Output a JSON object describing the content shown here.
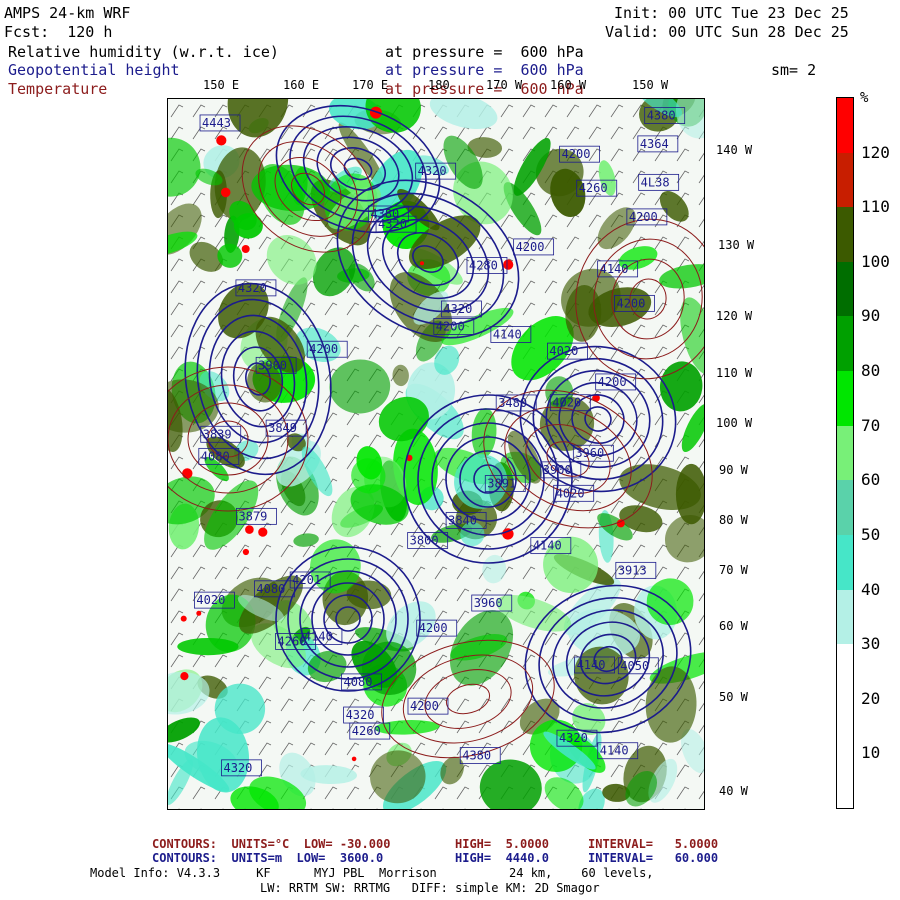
{
  "header": {
    "model": "AMPS 24-km WRF",
    "fcst": "Fcst:  120 h",
    "init": "Init: 00 UTC Tue 23 Dec 25",
    "valid": "Valid: 00 UTC Sun 28 Dec 25",
    "field1": "Relative humidity (w.r.t. ice)",
    "field1_level": "at pressure =  600 hPa",
    "field2": "Geopotential height",
    "field2_level": "at pressure =  600 hPa",
    "field3": "Temperature",
    "field3_level": "at pressure =  600 hPa",
    "smoothing": "sm= 2"
  },
  "top_lon_labels": [
    "150 E",
    "160 E",
    "170 E",
    "180",
    "170 W",
    "160 W",
    "150 W"
  ],
  "right_lat_labels": [
    "140 W",
    "130 W",
    "120 W",
    "110 W",
    "100 W",
    "90 W",
    "80 W",
    "70 W",
    "60 W",
    "50 W",
    "40 W"
  ],
  "colorbar": {
    "unit": "%",
    "labels": [
      "120",
      "110",
      "100",
      "90",
      "80",
      "70",
      "60",
      "50",
      "40",
      "30",
      "20",
      "10"
    ],
    "colors": [
      "#ff0000",
      "#c81e00",
      "#3c5a00",
      "#006e00",
      "#00a000",
      "#00e600",
      "#78f078",
      "#5ad2aa",
      "#46e6c8",
      "#b4f0e6",
      "#ffffff",
      "#ffffff",
      "#ffffff"
    ]
  },
  "map": {
    "height_labels": [
      "4380",
      "4443",
      "4364",
      "4200",
      "4320",
      "4L38",
      "4260",
      "4200",
      "4380",
      "4320",
      "4200",
      "4280",
      "4140",
      "4320",
      "4200",
      "4320",
      "4200",
      "4140",
      "4020",
      "4200",
      "3900",
      "4200",
      "3480",
      "4020",
      "3849",
      "3839",
      "3960",
      "4080",
      "3900",
      "3891",
      "4020",
      "3879",
      "3840",
      "4140",
      "3800",
      "3913",
      "4201",
      "4080",
      "4020",
      "3960",
      "4200",
      "4140",
      "4260",
      "4140",
      "4050",
      "4080",
      "4200",
      "4320",
      "4260",
      "4320",
      "4140",
      "4380",
      "4320"
    ],
    "height_label_color": "#1c1c8c",
    "contour_colors": {
      "height": "#1c1c8c",
      "temperature": "#8c1c1c"
    }
  },
  "footer": {
    "temp_contours": "CONTOURS:  UNITS=°C  LOW= -30.000",
    "temp_high": "HIGH=  5.0000",
    "temp_interval": "INTERVAL=   5.0000",
    "hgt_contours": "CONTOURS:  UNITS=m  LOW=  3600.0",
    "hgt_high": "HIGH=  4440.0",
    "hgt_interval": "INTERVAL=   60.000",
    "model_info": "Model Info: V4.3.3     KF      MYJ PBL  Morrison          24 km,    60 levels,",
    "model_info2": "LW: RRTM SW: RRTMG   DIFF: simple KM: 2D Smagor"
  }
}
